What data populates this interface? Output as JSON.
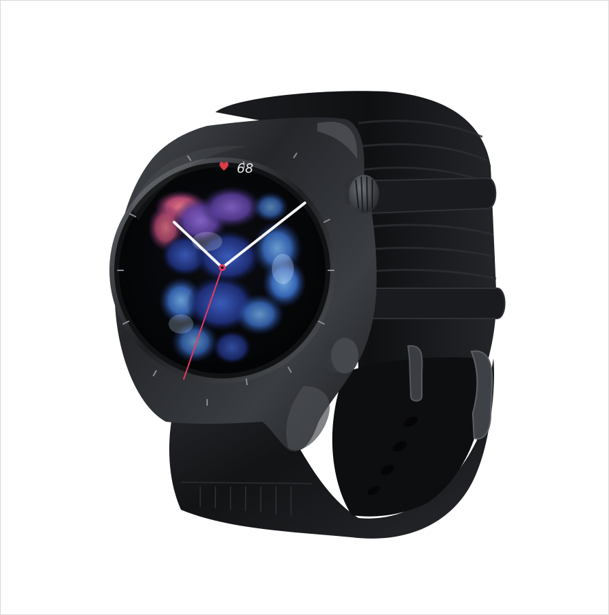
{
  "image": {
    "subject": "smartwatch-product-photo",
    "background_color": "#ffffff",
    "frame_border_color": "#d9d9d9"
  },
  "watch": {
    "case_color": "#2b2d31",
    "strap_color": "#17181a",
    "dial_color": "#050607",
    "heart_rate": {
      "icon": "heart-icon",
      "value": "68",
      "accent_color": "#d83c45"
    },
    "hands": {
      "primary_color": "#f7f7f7",
      "second_hand_color": "#e23b63"
    }
  }
}
